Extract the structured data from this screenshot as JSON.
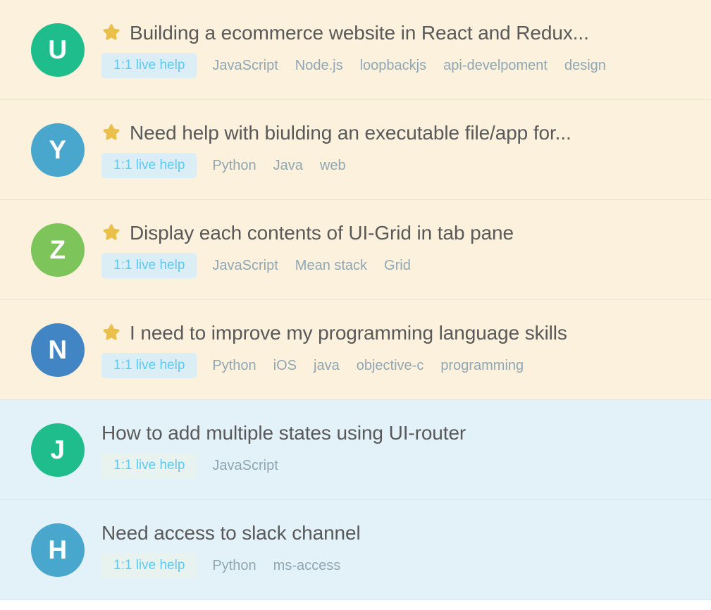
{
  "theme": {
    "cream_background": "#fbf1dd",
    "blue_background": "#e3f2f9",
    "divider": "#e6e3de",
    "title_color": "#595959",
    "tag_color": "#90a7b3",
    "badge_text_color": "#5ec8ef",
    "badge_background_cream_row": "#dbeef6",
    "badge_background_blue_row": "#e8f3ef",
    "star_color": "#ebc04a"
  },
  "list": {
    "name": "question-list",
    "star_icon_name": "star-icon",
    "rows": [
      {
        "avatar": {
          "initial": "U",
          "color": "#1fbc8c"
        },
        "starred": true,
        "title": "Building a ecommerce website in React and Redux...",
        "badge": "1:1 live help",
        "tags": [
          "JavaScript",
          "Node.js",
          "loopbackjs",
          "api-develpoment",
          "design"
        ],
        "theme": "cream"
      },
      {
        "avatar": {
          "initial": "Y",
          "color": "#49a6cc"
        },
        "starred": true,
        "title": "Need help with biulding an executable file/app for...",
        "badge": "1:1 live help",
        "tags": [
          "Python",
          "Java",
          "web"
        ],
        "theme": "cream"
      },
      {
        "avatar": {
          "initial": "Z",
          "color": "#7dc55a"
        },
        "starred": true,
        "title": "Display each contents of UI-Grid in tab pane",
        "badge": "1:1 live help",
        "tags": [
          "JavaScript",
          "Mean stack",
          "Grid"
        ],
        "theme": "cream"
      },
      {
        "avatar": {
          "initial": "N",
          "color": "#4285c4"
        },
        "starred": true,
        "title": "I need to improve my programming language skills",
        "badge": "1:1 live help",
        "tags": [
          "Python",
          "iOS",
          "java",
          "objective-c",
          "programming"
        ],
        "theme": "cream"
      },
      {
        "avatar": {
          "initial": "J",
          "color": "#1fbc8c"
        },
        "starred": false,
        "title": "How to add multiple states using UI-router",
        "badge": "1:1 live help",
        "tags": [
          "JavaScript"
        ],
        "theme": "blue"
      },
      {
        "avatar": {
          "initial": "H",
          "color": "#49a6cc"
        },
        "starred": false,
        "title": "Need access to slack channel",
        "badge": "1:1 live help",
        "tags": [
          "Python",
          "ms-access"
        ],
        "theme": "blue"
      }
    ]
  }
}
